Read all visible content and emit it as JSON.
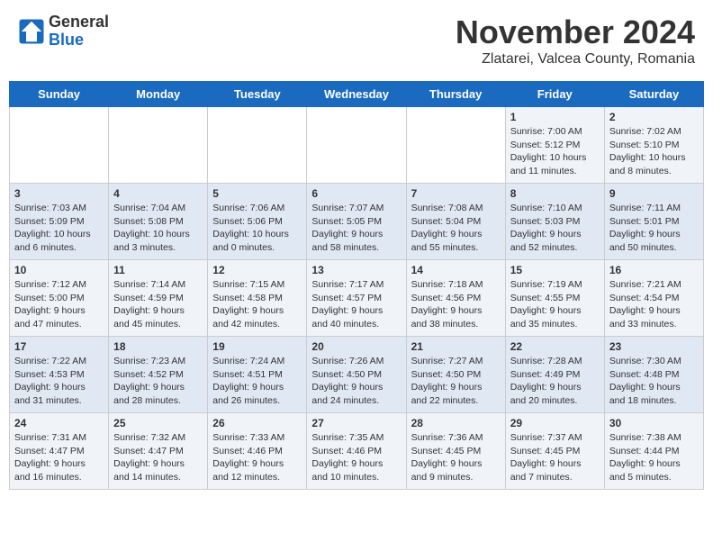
{
  "header": {
    "logo_general": "General",
    "logo_blue": "Blue",
    "month_title": "November 2024",
    "location": "Zlatarei, Valcea County, Romania"
  },
  "days_of_week": [
    "Sunday",
    "Monday",
    "Tuesday",
    "Wednesday",
    "Thursday",
    "Friday",
    "Saturday"
  ],
  "weeks": [
    [
      {
        "day": "",
        "content": ""
      },
      {
        "day": "",
        "content": ""
      },
      {
        "day": "",
        "content": ""
      },
      {
        "day": "",
        "content": ""
      },
      {
        "day": "",
        "content": ""
      },
      {
        "day": "1",
        "content": "Sunrise: 7:00 AM\nSunset: 5:12 PM\nDaylight: 10 hours and 11 minutes."
      },
      {
        "day": "2",
        "content": "Sunrise: 7:02 AM\nSunset: 5:10 PM\nDaylight: 10 hours and 8 minutes."
      }
    ],
    [
      {
        "day": "3",
        "content": "Sunrise: 7:03 AM\nSunset: 5:09 PM\nDaylight: 10 hours and 6 minutes."
      },
      {
        "day": "4",
        "content": "Sunrise: 7:04 AM\nSunset: 5:08 PM\nDaylight: 10 hours and 3 minutes."
      },
      {
        "day": "5",
        "content": "Sunrise: 7:06 AM\nSunset: 5:06 PM\nDaylight: 10 hours and 0 minutes."
      },
      {
        "day": "6",
        "content": "Sunrise: 7:07 AM\nSunset: 5:05 PM\nDaylight: 9 hours and 58 minutes."
      },
      {
        "day": "7",
        "content": "Sunrise: 7:08 AM\nSunset: 5:04 PM\nDaylight: 9 hours and 55 minutes."
      },
      {
        "day": "8",
        "content": "Sunrise: 7:10 AM\nSunset: 5:03 PM\nDaylight: 9 hours and 52 minutes."
      },
      {
        "day": "9",
        "content": "Sunrise: 7:11 AM\nSunset: 5:01 PM\nDaylight: 9 hours and 50 minutes."
      }
    ],
    [
      {
        "day": "10",
        "content": "Sunrise: 7:12 AM\nSunset: 5:00 PM\nDaylight: 9 hours and 47 minutes."
      },
      {
        "day": "11",
        "content": "Sunrise: 7:14 AM\nSunset: 4:59 PM\nDaylight: 9 hours and 45 minutes."
      },
      {
        "day": "12",
        "content": "Sunrise: 7:15 AM\nSunset: 4:58 PM\nDaylight: 9 hours and 42 minutes."
      },
      {
        "day": "13",
        "content": "Sunrise: 7:17 AM\nSunset: 4:57 PM\nDaylight: 9 hours and 40 minutes."
      },
      {
        "day": "14",
        "content": "Sunrise: 7:18 AM\nSunset: 4:56 PM\nDaylight: 9 hours and 38 minutes."
      },
      {
        "day": "15",
        "content": "Sunrise: 7:19 AM\nSunset: 4:55 PM\nDaylight: 9 hours and 35 minutes."
      },
      {
        "day": "16",
        "content": "Sunrise: 7:21 AM\nSunset: 4:54 PM\nDaylight: 9 hours and 33 minutes."
      }
    ],
    [
      {
        "day": "17",
        "content": "Sunrise: 7:22 AM\nSunset: 4:53 PM\nDaylight: 9 hours and 31 minutes."
      },
      {
        "day": "18",
        "content": "Sunrise: 7:23 AM\nSunset: 4:52 PM\nDaylight: 9 hours and 28 minutes."
      },
      {
        "day": "19",
        "content": "Sunrise: 7:24 AM\nSunset: 4:51 PM\nDaylight: 9 hours and 26 minutes."
      },
      {
        "day": "20",
        "content": "Sunrise: 7:26 AM\nSunset: 4:50 PM\nDaylight: 9 hours and 24 minutes."
      },
      {
        "day": "21",
        "content": "Sunrise: 7:27 AM\nSunset: 4:50 PM\nDaylight: 9 hours and 22 minutes."
      },
      {
        "day": "22",
        "content": "Sunrise: 7:28 AM\nSunset: 4:49 PM\nDaylight: 9 hours and 20 minutes."
      },
      {
        "day": "23",
        "content": "Sunrise: 7:30 AM\nSunset: 4:48 PM\nDaylight: 9 hours and 18 minutes."
      }
    ],
    [
      {
        "day": "24",
        "content": "Sunrise: 7:31 AM\nSunset: 4:47 PM\nDaylight: 9 hours and 16 minutes."
      },
      {
        "day": "25",
        "content": "Sunrise: 7:32 AM\nSunset: 4:47 PM\nDaylight: 9 hours and 14 minutes."
      },
      {
        "day": "26",
        "content": "Sunrise: 7:33 AM\nSunset: 4:46 PM\nDaylight: 9 hours and 12 minutes."
      },
      {
        "day": "27",
        "content": "Sunrise: 7:35 AM\nSunset: 4:46 PM\nDaylight: 9 hours and 10 minutes."
      },
      {
        "day": "28",
        "content": "Sunrise: 7:36 AM\nSunset: 4:45 PM\nDaylight: 9 hours and 9 minutes."
      },
      {
        "day": "29",
        "content": "Sunrise: 7:37 AM\nSunset: 4:45 PM\nDaylight: 9 hours and 7 minutes."
      },
      {
        "day": "30",
        "content": "Sunrise: 7:38 AM\nSunset: 4:44 PM\nDaylight: 9 hours and 5 minutes."
      }
    ]
  ]
}
